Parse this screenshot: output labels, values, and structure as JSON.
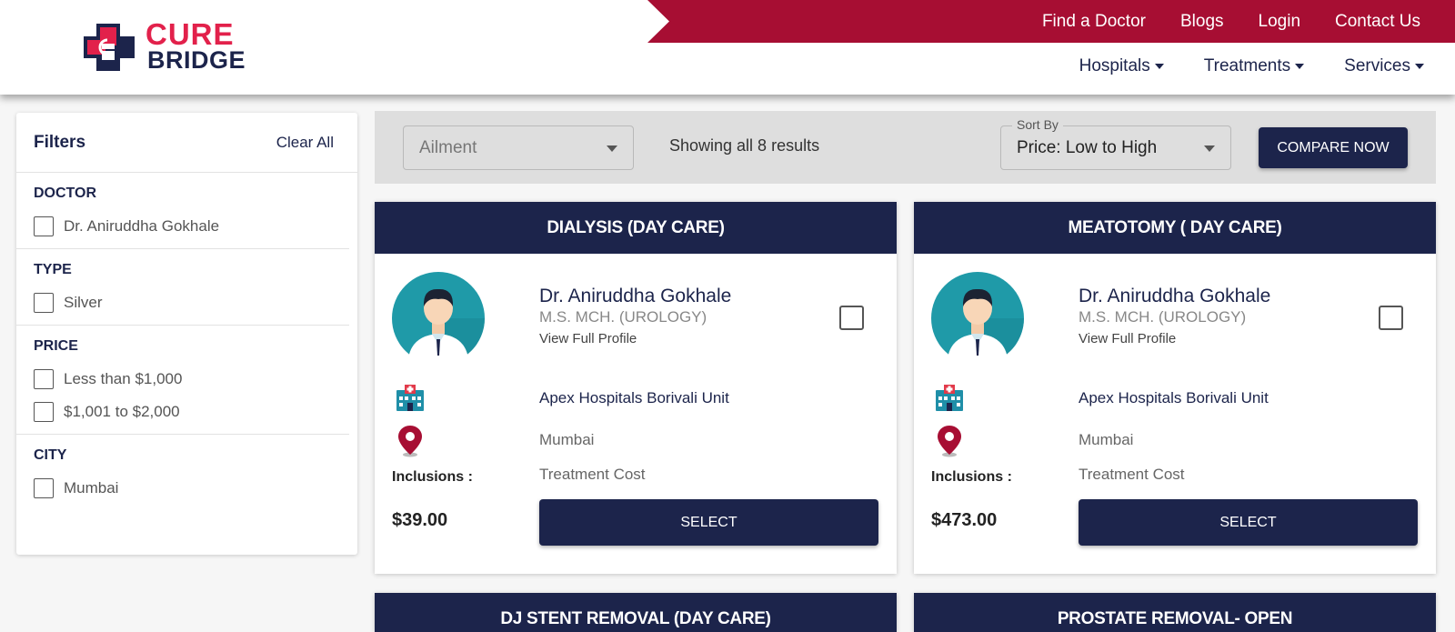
{
  "brand": {
    "line1": "CURE",
    "line2": "BRIDGE"
  },
  "topbar": {
    "links": [
      "Find a Doctor",
      "Blogs",
      "Login",
      "Contact Us"
    ]
  },
  "nav": {
    "items": [
      "Hospitals",
      "Treatments",
      "Services"
    ]
  },
  "filters": {
    "title": "Filters",
    "clear_label": "Clear All",
    "sections": [
      {
        "title": "DOCTOR",
        "options": [
          "Dr. Aniruddha Gokhale"
        ]
      },
      {
        "title": "TYPE",
        "options": [
          "Silver"
        ]
      },
      {
        "title": "PRICE",
        "options": [
          "Less than $1,000",
          "$1,001 to $2,000"
        ]
      },
      {
        "title": "CITY",
        "options": [
          "Mumbai"
        ]
      }
    ]
  },
  "toolbar": {
    "ailment_placeholder": "Ailment",
    "results_text": "Showing all 8 results",
    "sort_label": "Sort By",
    "sort_value": "Price: Low to High",
    "compare_label": "COMPARE NOW"
  },
  "cards": [
    {
      "title": "DIALYSIS (DAY CARE)",
      "doctor": "Dr. Aniruddha Gokhale",
      "qualification": "M.S. MCH. (UROLOGY)",
      "profile_link": "View Full Profile",
      "hospital": "Apex Hospitals Borivali Unit",
      "city": "Mumbai",
      "inclusions_label": "Inclusions :",
      "inclusions": "Treatment Cost",
      "price": "$39.00",
      "select_label": "SELECT"
    },
    {
      "title": "MEATOTOMY ( DAY CARE)",
      "doctor": "Dr. Aniruddha Gokhale",
      "qualification": "M.S. MCH. (UROLOGY)",
      "profile_link": "View Full Profile",
      "hospital": "Apex Hospitals Borivali Unit",
      "city": "Mumbai",
      "inclusions_label": "Inclusions :",
      "inclusions": "Treatment Cost",
      "price": "$473.00",
      "select_label": "SELECT"
    },
    {
      "title": "DJ STENT REMOVAL (DAY CARE)"
    },
    {
      "title": "PROSTATE REMOVAL- OPEN"
    }
  ],
  "colors": {
    "navy": "#1c244b",
    "crimson": "#a70e33",
    "brand_red": "#e2214b"
  }
}
